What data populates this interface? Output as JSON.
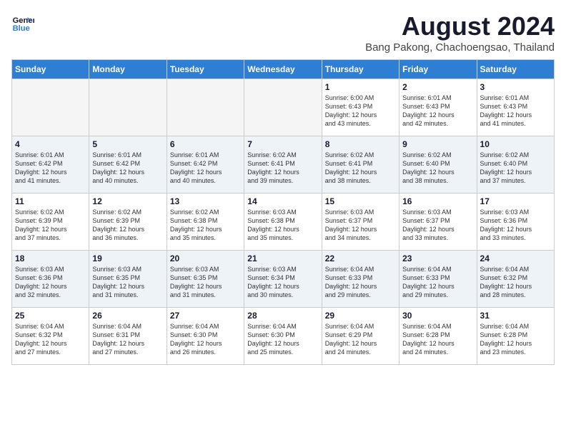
{
  "header": {
    "logo_line1": "General",
    "logo_line2": "Blue",
    "month_title": "August 2024",
    "location": "Bang Pakong, Chachoengsao, Thailand"
  },
  "weekdays": [
    "Sunday",
    "Monday",
    "Tuesday",
    "Wednesday",
    "Thursday",
    "Friday",
    "Saturday"
  ],
  "rows": [
    {
      "shade": "white",
      "cells": [
        {
          "empty": true
        },
        {
          "empty": true
        },
        {
          "empty": true
        },
        {
          "empty": true
        },
        {
          "day": "1",
          "info": "Sunrise: 6:00 AM\nSunset: 6:43 PM\nDaylight: 12 hours\nand 43 minutes."
        },
        {
          "day": "2",
          "info": "Sunrise: 6:01 AM\nSunset: 6:43 PM\nDaylight: 12 hours\nand 42 minutes."
        },
        {
          "day": "3",
          "info": "Sunrise: 6:01 AM\nSunset: 6:43 PM\nDaylight: 12 hours\nand 41 minutes."
        }
      ]
    },
    {
      "shade": "gray",
      "cells": [
        {
          "day": "4",
          "info": "Sunrise: 6:01 AM\nSunset: 6:42 PM\nDaylight: 12 hours\nand 41 minutes."
        },
        {
          "day": "5",
          "info": "Sunrise: 6:01 AM\nSunset: 6:42 PM\nDaylight: 12 hours\nand 40 minutes."
        },
        {
          "day": "6",
          "info": "Sunrise: 6:01 AM\nSunset: 6:42 PM\nDaylight: 12 hours\nand 40 minutes."
        },
        {
          "day": "7",
          "info": "Sunrise: 6:02 AM\nSunset: 6:41 PM\nDaylight: 12 hours\nand 39 minutes."
        },
        {
          "day": "8",
          "info": "Sunrise: 6:02 AM\nSunset: 6:41 PM\nDaylight: 12 hours\nand 38 minutes."
        },
        {
          "day": "9",
          "info": "Sunrise: 6:02 AM\nSunset: 6:40 PM\nDaylight: 12 hours\nand 38 minutes."
        },
        {
          "day": "10",
          "info": "Sunrise: 6:02 AM\nSunset: 6:40 PM\nDaylight: 12 hours\nand 37 minutes."
        }
      ]
    },
    {
      "shade": "white",
      "cells": [
        {
          "day": "11",
          "info": "Sunrise: 6:02 AM\nSunset: 6:39 PM\nDaylight: 12 hours\nand 37 minutes."
        },
        {
          "day": "12",
          "info": "Sunrise: 6:02 AM\nSunset: 6:39 PM\nDaylight: 12 hours\nand 36 minutes."
        },
        {
          "day": "13",
          "info": "Sunrise: 6:02 AM\nSunset: 6:38 PM\nDaylight: 12 hours\nand 35 minutes."
        },
        {
          "day": "14",
          "info": "Sunrise: 6:03 AM\nSunset: 6:38 PM\nDaylight: 12 hours\nand 35 minutes."
        },
        {
          "day": "15",
          "info": "Sunrise: 6:03 AM\nSunset: 6:37 PM\nDaylight: 12 hours\nand 34 minutes."
        },
        {
          "day": "16",
          "info": "Sunrise: 6:03 AM\nSunset: 6:37 PM\nDaylight: 12 hours\nand 33 minutes."
        },
        {
          "day": "17",
          "info": "Sunrise: 6:03 AM\nSunset: 6:36 PM\nDaylight: 12 hours\nand 33 minutes."
        }
      ]
    },
    {
      "shade": "gray",
      "cells": [
        {
          "day": "18",
          "info": "Sunrise: 6:03 AM\nSunset: 6:36 PM\nDaylight: 12 hours\nand 32 minutes."
        },
        {
          "day": "19",
          "info": "Sunrise: 6:03 AM\nSunset: 6:35 PM\nDaylight: 12 hours\nand 31 minutes."
        },
        {
          "day": "20",
          "info": "Sunrise: 6:03 AM\nSunset: 6:35 PM\nDaylight: 12 hours\nand 31 minutes."
        },
        {
          "day": "21",
          "info": "Sunrise: 6:03 AM\nSunset: 6:34 PM\nDaylight: 12 hours\nand 30 minutes."
        },
        {
          "day": "22",
          "info": "Sunrise: 6:04 AM\nSunset: 6:33 PM\nDaylight: 12 hours\nand 29 minutes."
        },
        {
          "day": "23",
          "info": "Sunrise: 6:04 AM\nSunset: 6:33 PM\nDaylight: 12 hours\nand 29 minutes."
        },
        {
          "day": "24",
          "info": "Sunrise: 6:04 AM\nSunset: 6:32 PM\nDaylight: 12 hours\nand 28 minutes."
        }
      ]
    },
    {
      "shade": "white",
      "cells": [
        {
          "day": "25",
          "info": "Sunrise: 6:04 AM\nSunset: 6:32 PM\nDaylight: 12 hours\nand 27 minutes."
        },
        {
          "day": "26",
          "info": "Sunrise: 6:04 AM\nSunset: 6:31 PM\nDaylight: 12 hours\nand 27 minutes."
        },
        {
          "day": "27",
          "info": "Sunrise: 6:04 AM\nSunset: 6:30 PM\nDaylight: 12 hours\nand 26 minutes."
        },
        {
          "day": "28",
          "info": "Sunrise: 6:04 AM\nSunset: 6:30 PM\nDaylight: 12 hours\nand 25 minutes."
        },
        {
          "day": "29",
          "info": "Sunrise: 6:04 AM\nSunset: 6:29 PM\nDaylight: 12 hours\nand 24 minutes."
        },
        {
          "day": "30",
          "info": "Sunrise: 6:04 AM\nSunset: 6:28 PM\nDaylight: 12 hours\nand 24 minutes."
        },
        {
          "day": "31",
          "info": "Sunrise: 6:04 AM\nSunset: 6:28 PM\nDaylight: 12 hours\nand 23 minutes."
        }
      ]
    }
  ]
}
